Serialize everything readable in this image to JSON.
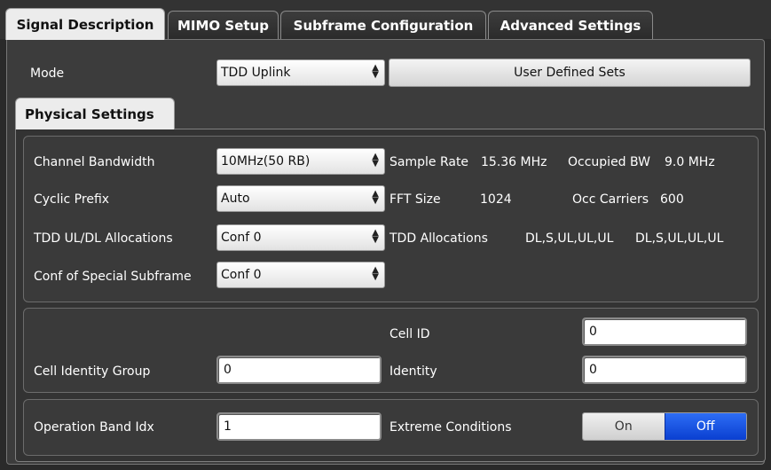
{
  "tabs": [
    {
      "label": "Signal Description",
      "active": true
    },
    {
      "label": "MIMO Setup",
      "active": false
    },
    {
      "label": "Subframe Configuration",
      "active": false
    },
    {
      "label": "Advanced Settings",
      "active": false
    }
  ],
  "mode": {
    "label": "Mode",
    "value": "TDD Uplink",
    "button": "User Defined Sets"
  },
  "physical": {
    "tab_label": "Physical Settings",
    "channel_bandwidth": {
      "label": "Channel Bandwidth",
      "value": "10MHz(50 RB)"
    },
    "sample_rate": {
      "label": "Sample Rate",
      "value": "15.36 MHz"
    },
    "occupied_bw": {
      "label": "Occupied BW",
      "value": "9.0 MHz"
    },
    "cyclic_prefix": {
      "label": "Cyclic Prefix",
      "value": "Auto"
    },
    "fft_size": {
      "label": "FFT Size",
      "value": "1024"
    },
    "occ_carriers": {
      "label": "Occ Carriers",
      "value": "600"
    },
    "tdd_alloc_select": {
      "label": "TDD UL/DL Allocations",
      "value": "Conf 0"
    },
    "tdd_allocations": {
      "label": "TDD Allocations",
      "value1": "DL,S,UL,UL,UL",
      "value2": "DL,S,UL,UL,UL"
    },
    "special_subframe": {
      "label": "Conf of Special Subframe",
      "value": "Conf 0"
    }
  },
  "cell": {
    "cell_id": {
      "label": "Cell ID",
      "value": "0"
    },
    "group": {
      "label": "Cell Identity Group",
      "value": "0"
    },
    "identity": {
      "label": "Identity",
      "value": "0"
    }
  },
  "band": {
    "operation_band": {
      "label": "Operation Band Idx",
      "value": "1"
    },
    "extreme": {
      "label": "Extreme Conditions",
      "on": "On",
      "off": "Off",
      "selected": "Off"
    }
  },
  "colors": {
    "accent": "#1a4fe0",
    "panel": "#3c3c3c",
    "background": "#2a2a2a"
  },
  "icons": {
    "select_arrow": "updown-arrow-icon"
  }
}
